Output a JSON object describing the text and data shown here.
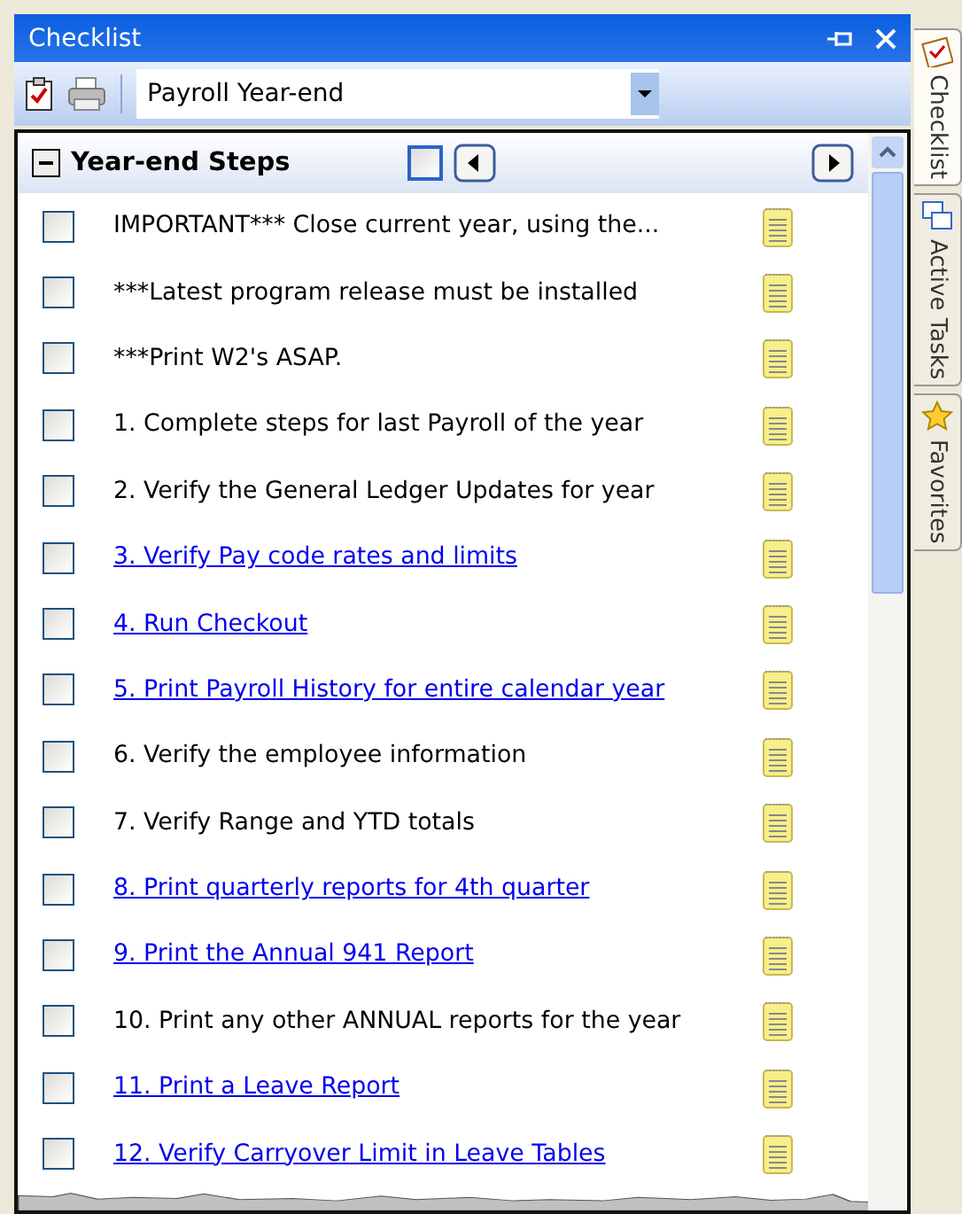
{
  "window": {
    "title": "Checklist"
  },
  "toolbar": {
    "dropdown": {
      "value": "Payroll Year-end"
    }
  },
  "section": {
    "title": "Year-end Steps",
    "expanded": true,
    "checked": false
  },
  "items": [
    {
      "label": "IMPORTANT*** Close current year, using the...",
      "kind": "text",
      "checked": false
    },
    {
      "label": "***Latest program release must be installed",
      "kind": "text",
      "checked": false
    },
    {
      "label": "***Print W2's ASAP.",
      "kind": "text",
      "checked": false
    },
    {
      "label": "1. Complete steps for last Payroll of the year",
      "kind": "text",
      "checked": false
    },
    {
      "label": "2. Verify the General Ledger Updates for year",
      "kind": "text",
      "checked": false
    },
    {
      "label": "3. Verify Pay code rates and limits",
      "kind": "link",
      "checked": false
    },
    {
      "label": "4. Run Checkout",
      "kind": "link",
      "checked": false
    },
    {
      "label": "5. Print Payroll History for entire calendar year",
      "kind": "link",
      "checked": false
    },
    {
      "label": "6. Verify the employee information",
      "kind": "text",
      "checked": false
    },
    {
      "label": "7. Verify Range and YTD totals",
      "kind": "text",
      "checked": false
    },
    {
      "label": "8. Print quarterly reports for 4th quarter",
      "kind": "link",
      "checked": false
    },
    {
      "label": "9. Print the Annual 941 Report",
      "kind": "link",
      "checked": false
    },
    {
      "label": "10. Print any other ANNUAL reports for the year",
      "kind": "text",
      "checked": false
    },
    {
      "label": "11. Print a Leave Report",
      "kind": "link",
      "checked": false
    },
    {
      "label": "12. Verify Carryover Limit in Leave Tables",
      "kind": "link",
      "checked": false
    }
  ],
  "side_tabs": [
    {
      "label": "Checklist",
      "selected": true
    },
    {
      "label": "Active Tasks",
      "selected": false
    },
    {
      "label": "Favorites",
      "selected": false
    }
  ]
}
